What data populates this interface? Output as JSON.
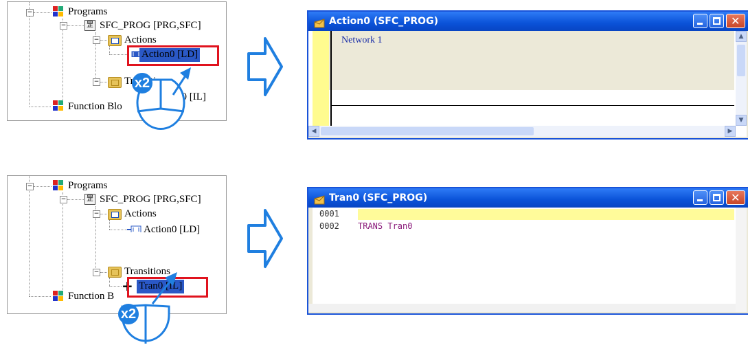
{
  "top_tree": {
    "programs": "Programs",
    "sfc_prog": "SFC_PROG [PRG,SFC]",
    "actions": "Actions",
    "action0": "Action0 [LD]",
    "transitions": "Transitions",
    "tran0_partial": "n0 [IL]",
    "function_blocks": "Function Blo"
  },
  "bottom_tree": {
    "programs": "Programs",
    "sfc_prog": "SFC_PROG [PRG,SFC]",
    "actions": "Actions",
    "action0": "Action0 [LD]",
    "transitions": "Transitions",
    "tran0": "Tran0 [IL]",
    "function_blocks": "Function B"
  },
  "double_click_badge": "x2",
  "action_window": {
    "title": "Action0 (SFC_PROG)",
    "network_label": "Network 1"
  },
  "tran_window": {
    "title": "Tran0 (SFC_PROG)",
    "lines": [
      {
        "num": "0001",
        "text": ""
      },
      {
        "num": "0002",
        "text": "TRANS Tran0"
      }
    ]
  },
  "colors": {
    "highlight": "#2a58c6",
    "red_box": "#e0131e",
    "arrow": "#1f7fe0",
    "titlebar": "#0a52d8"
  },
  "icons": [
    "program-group-icon",
    "sfc-program-icon",
    "folder-icon",
    "ld-action-icon",
    "transition-icon",
    "arrow-right-icon",
    "double-click-icon"
  ]
}
